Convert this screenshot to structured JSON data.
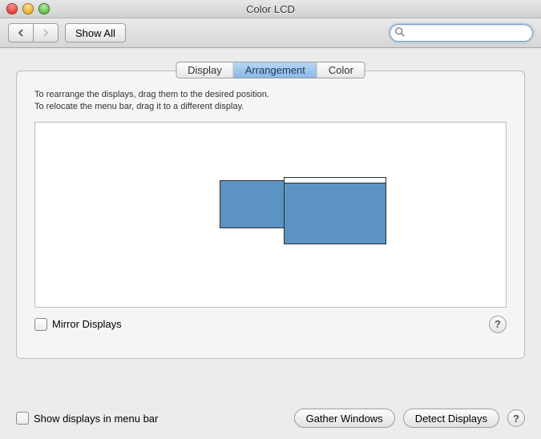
{
  "window": {
    "title": "Color LCD"
  },
  "toolbar": {
    "show_all_label": "Show All",
    "search_placeholder": ""
  },
  "tabs": {
    "display": "Display",
    "arrangement": "Arrangement",
    "color": "Color",
    "active": "arrangement"
  },
  "arrangement": {
    "instruction_line1": "To rearrange the displays, drag them to the desired position.",
    "instruction_line2": "To relocate the menu bar, drag it to a different display.",
    "mirror_label": "Mirror Displays",
    "mirror_checked": false,
    "displays": [
      {
        "id": "primary",
        "has_menu_bar": true
      },
      {
        "id": "secondary",
        "has_menu_bar": false
      }
    ]
  },
  "footer": {
    "show_in_menu_bar_label": "Show displays in menu bar",
    "show_in_menu_bar_checked": false,
    "gather_windows_label": "Gather Windows",
    "detect_displays_label": "Detect Displays"
  },
  "help_glyph": "?"
}
